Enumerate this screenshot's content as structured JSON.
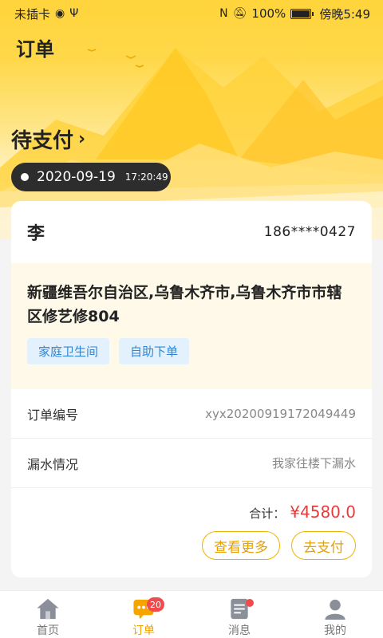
{
  "status_bar": {
    "carrier": "未插卡",
    "battery_pct": "100%",
    "time": "傍晚5:49"
  },
  "header": {
    "title": "订单"
  },
  "order": {
    "status": "待支付",
    "date": "2020-09-19",
    "time": "17:20:49",
    "customer_name": "李",
    "phone": "186****0427",
    "address": "新疆维吾尔自治区,乌鲁木齐市,乌鲁木齐市市辖区修艺修804",
    "tags": [
      "家庭卫生间",
      "自助下单"
    ],
    "details": [
      {
        "label": "订单编号",
        "value": "xyx20200919172049449"
      },
      {
        "label": "漏水情况",
        "value": "我家往楼下漏水"
      }
    ],
    "total_label": "合计：",
    "total_value": "¥4580.0",
    "more_button": "查看更多",
    "pay_button": "去支付"
  },
  "tabbar": {
    "items": [
      {
        "label": "首页",
        "icon": "home-icon"
      },
      {
        "label": "订单",
        "icon": "order-icon",
        "badge": "20"
      },
      {
        "label": "消息",
        "icon": "message-icon"
      },
      {
        "label": "我的",
        "icon": "profile-icon"
      }
    ]
  },
  "colors": {
    "accent": "#f0a300",
    "price": "#e83c3c",
    "tag_bg": "#e3f1fd",
    "tag_text": "#2e86d6"
  }
}
